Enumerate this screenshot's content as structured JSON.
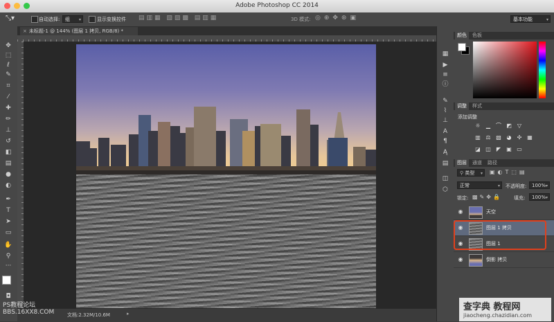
{
  "app": {
    "title": "Adobe Photoshop CC 2014"
  },
  "options_bar": {
    "auto_select_label": "自动选择:",
    "auto_select_value": "组",
    "show_transform_label": "显示变换控件",
    "mode_3d_label": "3D 模式:",
    "workspace_value": "基本功能"
  },
  "document_tab": {
    "label": "未标题-1 @ 144% (图层 1 拷贝, RGB/8) *"
  },
  "status_bar": {
    "doc_info": "文档:2.32M/10.6M"
  },
  "color_panel": {
    "tabs": [
      "颜色",
      "色板"
    ],
    "foreground": "#000000",
    "background": "#ffffff",
    "hue_color": "#e0161d"
  },
  "adjustments_panel": {
    "tabs": [
      "调整",
      "样式"
    ],
    "title": "添加调整"
  },
  "layers_panel": {
    "tabs": [
      "图层",
      "通道",
      "路径"
    ],
    "filter_value": "类型",
    "blend_mode": "正常",
    "opacity_label": "不透明度:",
    "opacity_value": "100%",
    "lock_label": "锁定:",
    "fill_label": "填充:",
    "fill_value": "100%",
    "layers": [
      {
        "name": "天空",
        "visible": true,
        "selected": false
      },
      {
        "name": "图层 1 拷贝",
        "visible": true,
        "selected": true
      },
      {
        "name": "图层 1",
        "visible": true,
        "selected": false
      },
      {
        "name": "倒影 拷贝",
        "visible": true,
        "selected": false
      }
    ]
  },
  "watermarks": {
    "left_line1": "PS教程论坛",
    "left_line2": "BBS.16XX8.COM",
    "right_line1": "查字典 教程网",
    "right_line2": "jiaocheng.chazidian.com"
  },
  "colors": {
    "highlight_border": "#e2401c",
    "selected_layer": "#5f6a7e"
  }
}
